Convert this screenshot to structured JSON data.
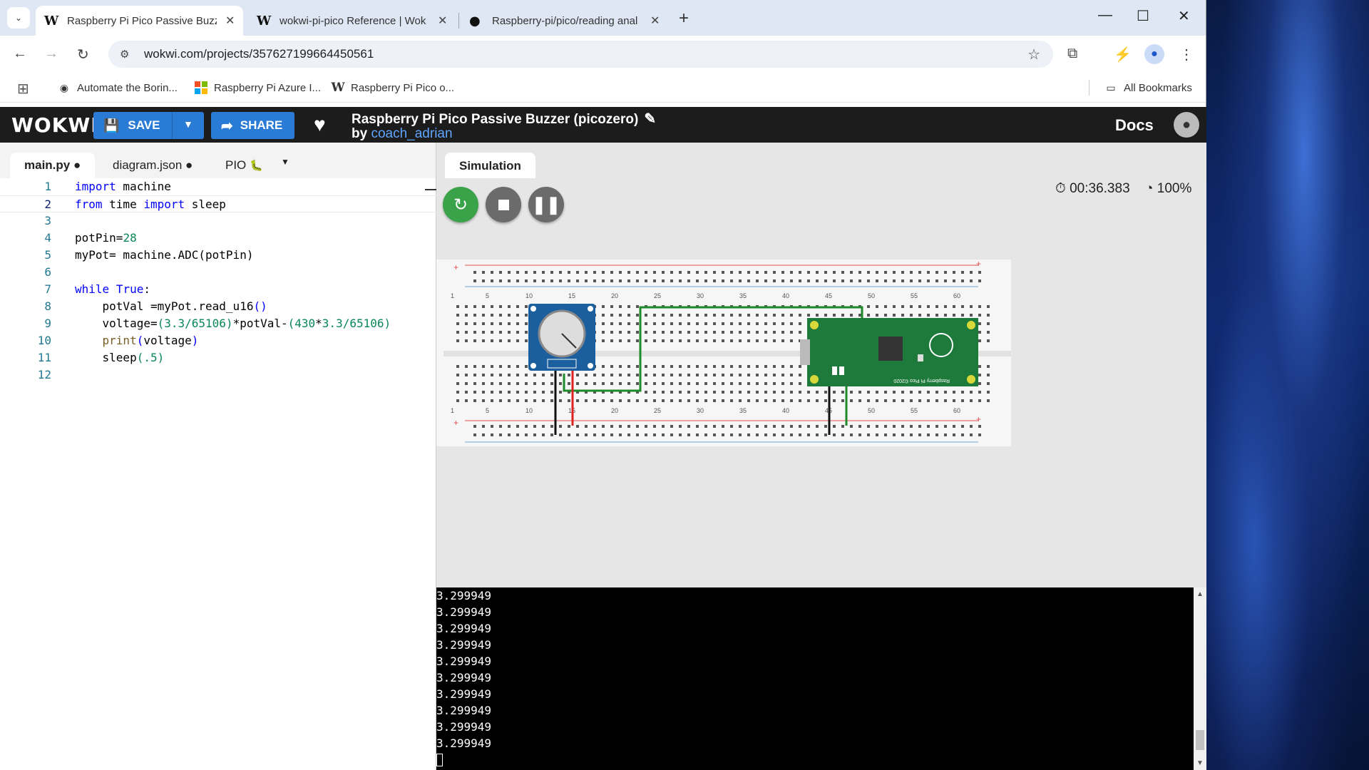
{
  "browser": {
    "tabs": [
      {
        "title": "Raspberry Pi Pico Passive Buzze",
        "icon": "W"
      },
      {
        "title": "wokwi-pi-pico Reference | Wok",
        "icon": "W"
      },
      {
        "title": "Raspberry-pi/pico/reading anal",
        "icon": "github-icon"
      }
    ],
    "url": "wokwi.com/projects/357627199664450561",
    "bookmarks": [
      {
        "label": "Automate the Borin...",
        "icon": "globe-icon"
      },
      {
        "label": "Raspberry Pi Azure I...",
        "icon": "windows-icon"
      },
      {
        "label": "Raspberry Pi Pico o...",
        "icon": "W"
      }
    ],
    "all_bookmarks": "All Bookmarks"
  },
  "header": {
    "logo": "WOKWI",
    "save_label": "SAVE",
    "share_label": "SHARE",
    "title": "Raspberry Pi Pico Passive Buzzer (picozero)",
    "by": "by",
    "author": "coach_adrian",
    "docs": "Docs"
  },
  "editor": {
    "tabs": [
      {
        "label": "main.py ●"
      },
      {
        "label": "diagram.json ●"
      },
      {
        "label": "PIO"
      }
    ],
    "lines": [
      "1",
      "2",
      "3",
      "4",
      "5",
      "6",
      "7",
      "8",
      "9",
      "10",
      "11",
      "12"
    ]
  },
  "simulation": {
    "tab": "Simulation",
    "timer": "00:36.383",
    "speed": "100%"
  },
  "serial": {
    "lines": [
      "3.299949",
      "3.299949",
      "3.299949",
      "3.299949",
      "3.299949",
      "3.299949",
      "3.299949",
      "3.299949",
      "3.299949",
      "3.299949"
    ]
  }
}
